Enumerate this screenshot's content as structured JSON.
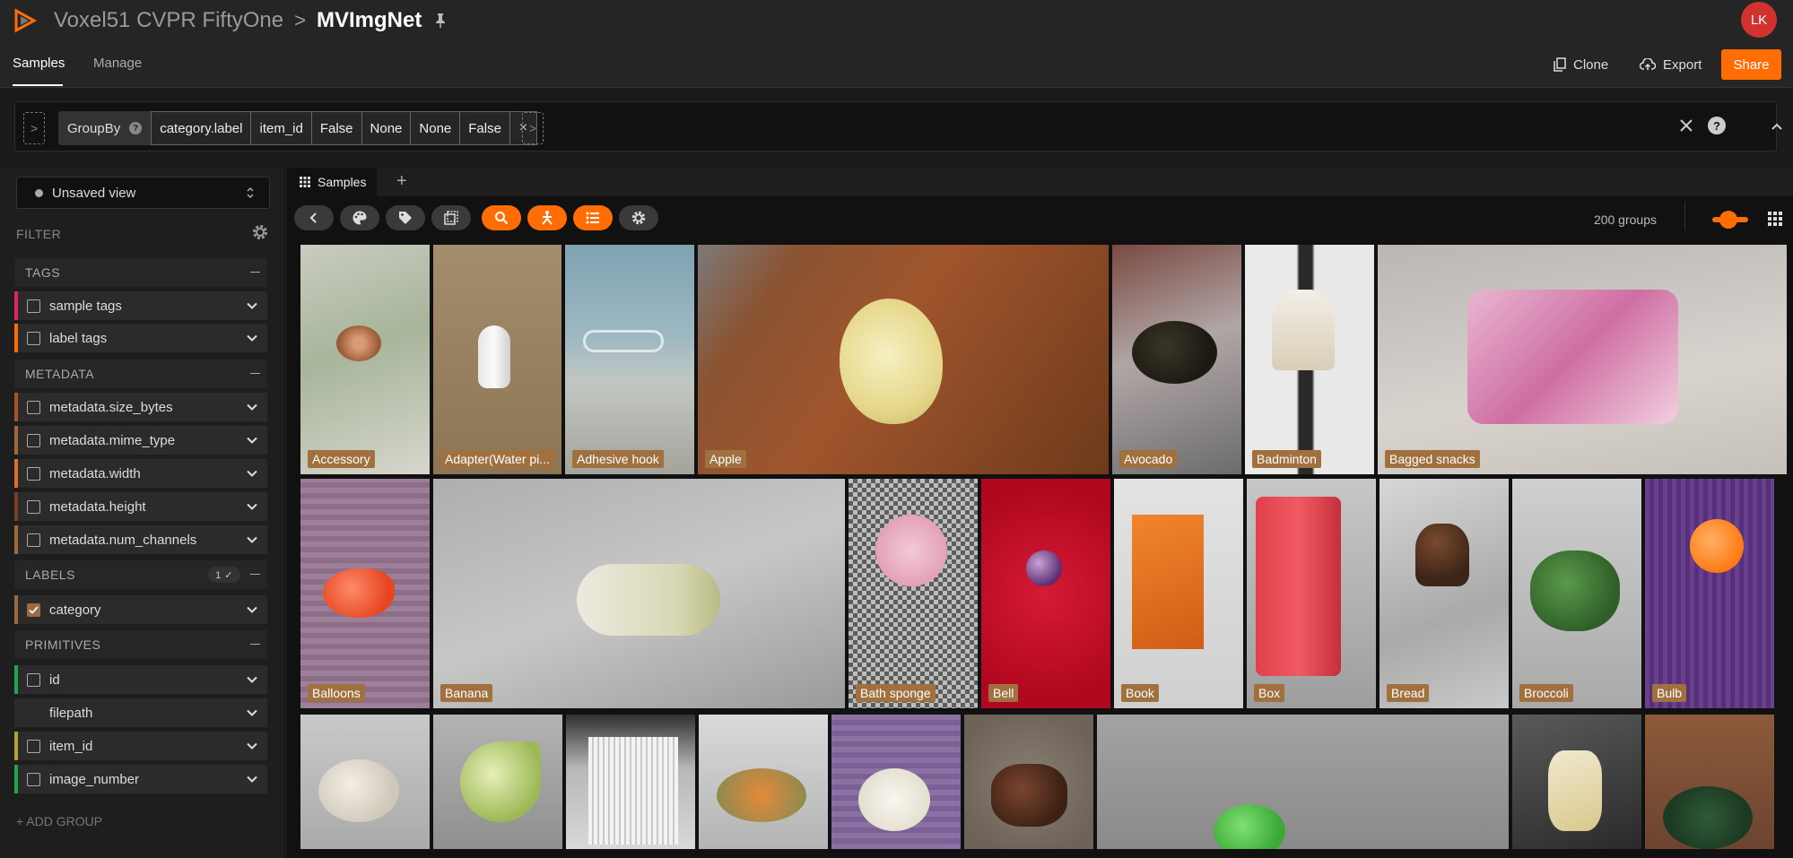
{
  "header": {
    "org": "Voxel51 CVPR FiftyOne",
    "separator": ">",
    "dataset": "MVImgNet",
    "user_initials": "LK"
  },
  "nav": {
    "tabs": [
      "Samples",
      "Manage"
    ],
    "clone_label": "Clone",
    "export_label": "Export",
    "share_label": "Share"
  },
  "view_bar": {
    "stage_name": "GroupBy",
    "help_glyph": "?",
    "params": [
      "category.label",
      "item_id",
      "False",
      "None",
      "None",
      "False"
    ],
    "close_glyph": "×",
    "expand_glyph": ">"
  },
  "sidebar": {
    "view_select": "Unsaved view",
    "filter_label": "FILTER",
    "add_group": "+ ADD GROUP",
    "groups": [
      {
        "name": "TAGS",
        "fields": [
          {
            "label": "sample tags",
            "color": "#e0245e"
          },
          {
            "label": "label tags",
            "color": "#ff6d04"
          }
        ]
      },
      {
        "name": "METADATA",
        "fields": [
          {
            "label": "metadata.size_bytes",
            "color": "#a9522c"
          },
          {
            "label": "metadata.mime_type",
            "color": "#9c6a3a"
          },
          {
            "label": "metadata.width",
            "color": "#d9712c"
          },
          {
            "label": "metadata.height",
            "color": "#7b3e1f"
          },
          {
            "label": "metadata.num_channels",
            "color": "#a06a3a"
          }
        ]
      },
      {
        "name": "LABELS",
        "badge": "1 ✓",
        "fields": [
          {
            "label": "category",
            "color": "#9e6a42",
            "checked": true
          }
        ]
      },
      {
        "name": "PRIMITIVES",
        "fields": [
          {
            "label": "id",
            "color": "#1ea84b"
          },
          {
            "label": "filepath",
            "color": "#2b2b2b"
          },
          {
            "label": "item_id",
            "color": "#b3a13a"
          },
          {
            "label": "image_number",
            "color": "#1ea84b"
          }
        ]
      }
    ]
  },
  "main": {
    "tab_label": "Samples",
    "tab_add": "+",
    "groups_count": "200 groups",
    "tiles_row1": [
      "Accessory",
      "Adapter(Water pi...",
      "Adhesive hook",
      "Apple",
      "Avocado",
      "Badminton",
      "Bagged snacks"
    ],
    "tiles_row2": [
      "Balloons",
      "Banana",
      "Bath sponge",
      "Bell",
      "Book",
      "Box",
      "Bread",
      "Broccoli",
      "Bulb"
    ]
  },
  "colors": {
    "accent": "#ff6d04",
    "label_bg": "#a0703f",
    "avatar": "#d2322d"
  }
}
